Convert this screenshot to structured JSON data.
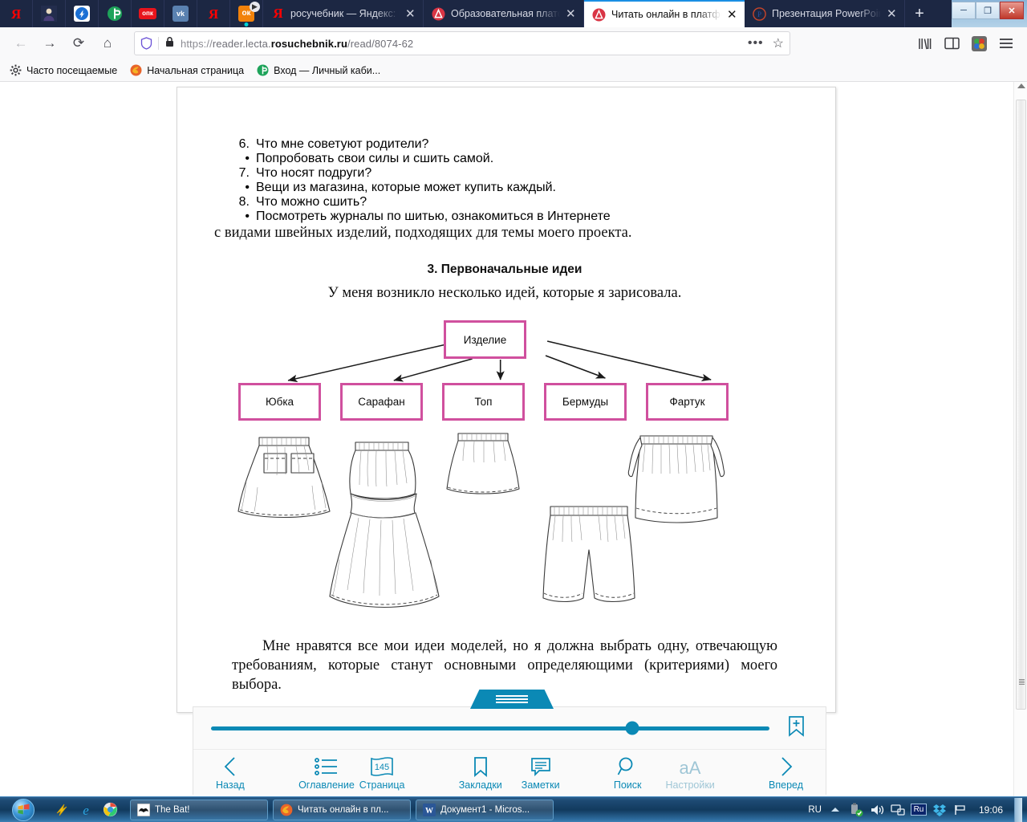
{
  "browser": {
    "pinned_tabs": [
      {
        "name": "yandex",
        "glyph": "Я"
      },
      {
        "name": "avatar",
        "glyph": " "
      },
      {
        "name": "blue-app",
        "glyph": " "
      },
      {
        "name": "green-app",
        "glyph": " "
      },
      {
        "name": "opk",
        "glyph": "опк"
      },
      {
        "name": "vk",
        "glyph": "vk"
      },
      {
        "name": "yandex2",
        "glyph": "Я"
      },
      {
        "name": "odnoklassniki",
        "glyph": "ок"
      }
    ],
    "tabs": [
      {
        "title": "росучебник — Яндекс: н",
        "favicon": "yandex-favicon",
        "active": false
      },
      {
        "title": "Образовательная платф",
        "favicon": "lecta-favicon",
        "active": false
      },
      {
        "title": "Читать онлайн в платфо",
        "favicon": "lecta-favicon",
        "active": true
      },
      {
        "title": "Презентация PowerPoint",
        "favicon": "powerpoint-favicon",
        "active": false
      }
    ],
    "new_tab_label": "+",
    "window_controls": {
      "minimize": "─",
      "maximize": "❐",
      "close": "✕"
    },
    "nav": {
      "back": "←",
      "forward": "→",
      "reload": "⟳",
      "home": "⌂",
      "page_actions": "•••",
      "bookmark_star": "☆"
    },
    "url": {
      "scheme": "https://",
      "subdomain": "reader.lecta.",
      "domain": "rosuchebnik.ru",
      "path": "/read/8074-62",
      "full": "https://reader.lecta.rosuchebnik.ru/read/8074-62"
    },
    "toolbar_right": [
      "library-icon",
      "sidebar-icon",
      "extension-icon",
      "menu-icon"
    ],
    "bookmarks": [
      {
        "label": "Часто посещаемые",
        "icon": "gear-icon"
      },
      {
        "label": "Начальная страница",
        "icon": "firefox-icon"
      },
      {
        "label": "Вход — Личный каби...",
        "icon": "lecta-green-icon"
      }
    ]
  },
  "document": {
    "list_items": [
      {
        "marker": "6.",
        "text": "Что мне советуют родители?"
      },
      {
        "marker": "•",
        "text": "Попробовать свои силы и сшить самой."
      },
      {
        "marker": "7.",
        "text": "Что носят подруги?"
      },
      {
        "marker": "•",
        "text": "Вещи из магазина, которые может купить каждый."
      },
      {
        "marker": "8.",
        "text": "Что можно сшить?"
      },
      {
        "marker": "•",
        "text": "Посмотреть журналы по шитью, ознакомиться в Интернете"
      }
    ],
    "continuation": "с видами швейных изделий, подходящих для темы моего проекта.",
    "section_title": "3. Первоначальные идеи",
    "intro": "У меня возникло несколько идей, которые я зарисовала.",
    "closing": "Мне нравятся все мои идеи моделей, но я должна выбрать одну, отвечающую требованиям, которые станут основными определяющими (критериями) моего выбора."
  },
  "diagram": {
    "root": "Изделие",
    "leaves": [
      "Юбка",
      "Сарафан",
      "Топ",
      "Бермуды",
      "Фартук"
    ],
    "border_color": "#d0509e"
  },
  "reader": {
    "accent_color": "#0b89b5",
    "progress_percent": 75,
    "page_number": "145",
    "add_bookmark_icon": "bookmark-plus-icon",
    "tools": [
      {
        "label": "Назад",
        "icon": "chevron-left-icon",
        "disabled": false
      },
      {
        "label": "Оглавление",
        "icon": "list-icon",
        "disabled": false
      },
      {
        "label": "Страница",
        "icon": "book-page-icon",
        "disabled": false
      },
      {
        "label": "Закладки",
        "icon": "bookmark-icon",
        "disabled": false
      },
      {
        "label": "Заметки",
        "icon": "note-icon",
        "disabled": false
      },
      {
        "label": "Поиск",
        "icon": "search-icon",
        "disabled": false
      },
      {
        "label": "Настройки",
        "icon": "font-size-icon",
        "disabled": true
      },
      {
        "label": "Вперед",
        "icon": "chevron-right-icon",
        "disabled": false
      }
    ]
  },
  "taskbar": {
    "start": "windows-orb",
    "quick_launch": [
      "media-player-icon",
      "internet-explorer-icon",
      "chrome-icon"
    ],
    "windows": [
      {
        "label": "The Bat!",
        "icon": "thebat-icon"
      },
      {
        "label": "Читать онлайн в пл...",
        "icon": "firefox-icon"
      },
      {
        "label": "Документ1 - Micros...",
        "icon": "word-icon"
      }
    ],
    "tray": {
      "language": "RU",
      "items": [
        "show-hidden-icon",
        "usb-safely-remove-icon",
        "volume-icon",
        "network-icon",
        "punto-ru-icon",
        "dropbox-icon",
        "flag-icon"
      ],
      "punto_label": "Ru",
      "clock": "19:06"
    }
  }
}
